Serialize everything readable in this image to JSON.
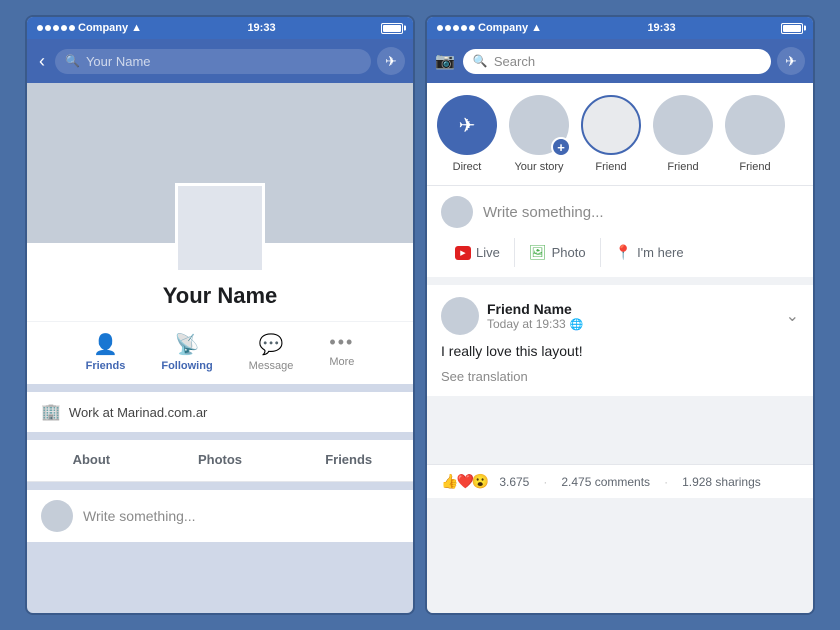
{
  "left_phone": {
    "status_bar": {
      "carrier": "Company",
      "time": "19:33"
    },
    "search_placeholder": "Your Name",
    "profile": {
      "name": "Your Name",
      "work": "Work at Marinad.com.ar",
      "actions": [
        {
          "label": "Friends",
          "icon": "👤"
        },
        {
          "label": "Following",
          "icon": "📡"
        },
        {
          "label": "Message",
          "icon": "💬"
        },
        {
          "label": "More",
          "icon": "•••"
        }
      ],
      "tabs": [
        "About",
        "Photos",
        "Friends"
      ],
      "write_placeholder": "Write something..."
    }
  },
  "right_phone": {
    "status_bar": {
      "carrier": "Company",
      "time": "19:33"
    },
    "search_placeholder": "Search",
    "stories": [
      {
        "label": "Direct",
        "type": "direct"
      },
      {
        "label": "Your story",
        "type": "add"
      },
      {
        "label": "Friend",
        "type": "bordered"
      },
      {
        "label": "Friend",
        "type": "plain"
      },
      {
        "label": "Friend",
        "type": "plain"
      }
    ],
    "composer": {
      "placeholder": "Write something...",
      "actions": [
        "Live",
        "Photo",
        "I'm here"
      ]
    },
    "post": {
      "friend_name": "Friend Name",
      "time": "Today at 19:33",
      "text": "I really love this layout!",
      "translation": "See translation",
      "reactions": {
        "count": "3.675",
        "comments": "2.475 comments",
        "shares": "1.928 sharings"
      }
    }
  }
}
